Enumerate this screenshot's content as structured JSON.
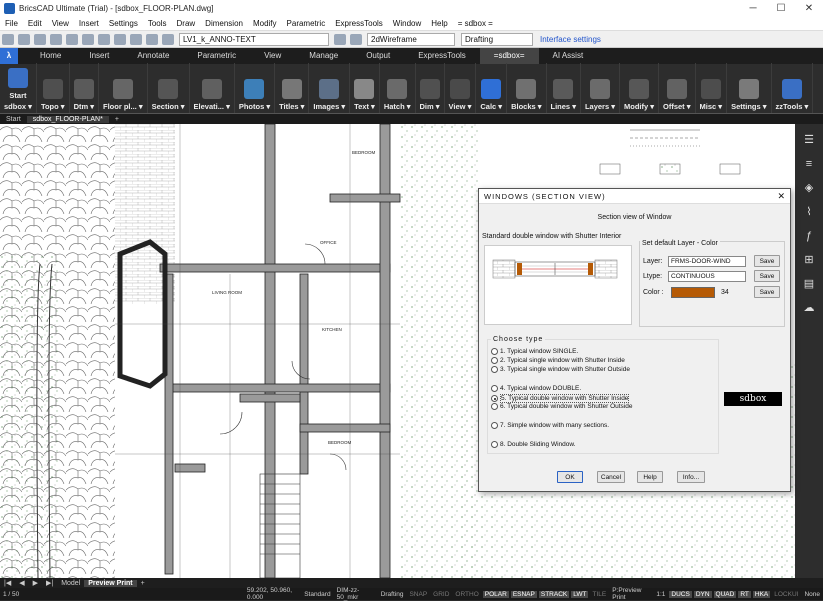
{
  "title": "BricsCAD Ultimate (Trial) - [sdbox_FLOOR-PLAN.dwg]",
  "menu": [
    "File",
    "Edit",
    "View",
    "Insert",
    "Settings",
    "Tools",
    "Draw",
    "Dimension",
    "Modify",
    "Parametric",
    "ExpressTools",
    "Window",
    "Help",
    "= sdbox ="
  ],
  "toolbar": {
    "layer_value": "LV1_k_ANNO-TEXT",
    "visual_style": "2dWireframe",
    "workspace": "Drafting",
    "interface_settings": "Interface settings"
  },
  "ribbon_tabs": [
    "Home",
    "Insert",
    "Annotate",
    "Parametric",
    "View",
    "Manage",
    "Output",
    "ExpressTools",
    "=sdbox=",
    "AI Assist"
  ],
  "ribbon_active_tab": "=sdbox=",
  "ribbon_groups": [
    {
      "label": "sdbox",
      "icon": "sdbox-start-icon",
      "extra": "Start"
    },
    {
      "label": "Topo",
      "icon": "topo-icon"
    },
    {
      "label": "Dtm",
      "icon": "dtm-icon"
    },
    {
      "label": "Floor pl...",
      "icon": "floor-plan-icon"
    },
    {
      "label": "Section",
      "icon": "section-icon"
    },
    {
      "label": "Elevati...",
      "icon": "elevation-icon"
    },
    {
      "label": "Photos",
      "icon": "photos-icon"
    },
    {
      "label": "Titles",
      "icon": "titles-icon"
    },
    {
      "label": "Images",
      "icon": "images-icon"
    },
    {
      "label": "Text",
      "icon": "text-icon"
    },
    {
      "label": "Hatch",
      "icon": "hatch-icon"
    },
    {
      "label": "Dim",
      "icon": "dim-icon"
    },
    {
      "label": "View",
      "icon": "view-icon"
    },
    {
      "label": "Calc",
      "icon": "calc-icon"
    },
    {
      "label": "Blocks",
      "icon": "blocks-icon"
    },
    {
      "label": "Lines",
      "icon": "lines-icon"
    },
    {
      "label": "Layers",
      "icon": "layers-icon"
    },
    {
      "label": "Modify",
      "icon": "modify-icon"
    },
    {
      "label": "Offset",
      "icon": "offset-icon"
    },
    {
      "label": "Misc",
      "icon": "misc-icon"
    },
    {
      "label": "Settings",
      "icon": "settings-icon"
    },
    {
      "label": "zzTools",
      "icon": "zztools-icon"
    }
  ],
  "doc_tabs": [
    "Start",
    "sdbox_FLOOR-PLAN*"
  ],
  "layout_tabs": [
    "Model",
    "Preview Print"
  ],
  "page_indicator": "1 / 50",
  "cmd_prompt": "None",
  "status": {
    "coords": "59.202, 50.960, 0.000",
    "items": [
      "Standard",
      "DIM-zz-50_mkr",
      "Drafting",
      "SNAP",
      "GRID",
      "ORTHO",
      "POLAR",
      "ESNAP",
      "STRACK",
      "LWT",
      "TILE",
      "P:Preview Print",
      "1:1",
      "DUCS",
      "DYN",
      "QUAD",
      "RT",
      "HKA",
      "LOCKUI",
      "None"
    ]
  },
  "drawing_labels": {
    "living_room": "LIVING ROOM",
    "kitchen": "KITCHEN",
    "office": "OFFICE",
    "bedroom_top": "BEDROOM",
    "bedroom_bottom": "BEDROOM"
  },
  "dialog": {
    "title": "WINDOWS (SECTION VIEW)",
    "subtitle": "Section view of Window",
    "description": "Standard double window with Shutter  Interior",
    "layer_box_header": "Set default Layer - Color",
    "layer_label": "Layer:",
    "layer_value": "FRMS-DOOR-WIND",
    "ltype_label": "Ltype:",
    "ltype_value": "CONTINUOUS",
    "color_label": "Color :",
    "color_value": "34",
    "color_hex": "#b55a05",
    "save_label": "Save",
    "choose_header": "Choose  type",
    "options": [
      "1. Typical window SINGLE.",
      "2. Typical single window with Shutter  Inside",
      "3. Typical single window with Shutter  Outside",
      "4. Typical window  DOUBLE.",
      "5. Typical double window with Shutter  Inside",
      "6. Typical double window with Shutter  Outside",
      "7. Simple window with many sections.",
      "8. Double Sliding Window."
    ],
    "selected_option": 4,
    "logo_text": "sdbox",
    "ok_label": "OK",
    "cancel_label": "Cancel",
    "help_label": "Help",
    "info_label": "Info..."
  }
}
